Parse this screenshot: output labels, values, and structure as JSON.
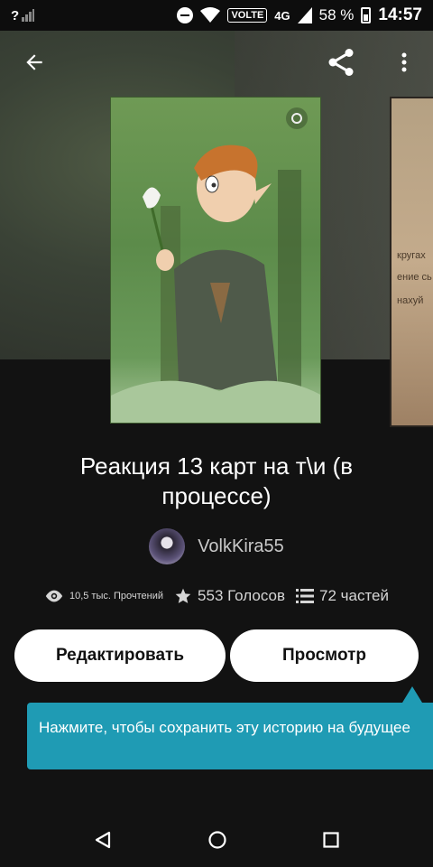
{
  "status_bar": {
    "signal_label": "?",
    "volte_label": "VOLTE",
    "network_label": "4G",
    "battery_text": "58 %",
    "time": "14:57"
  },
  "story": {
    "title": "Реакция 13 карт на т\\и (в процессе)",
    "author": "VolkKira55",
    "reads": "10,5 тыс. Прочтений",
    "votes": "553 Голосов",
    "parts": "72 частей"
  },
  "actions": {
    "edit_label": "Редактировать",
    "view_label": "Просмотр"
  },
  "tooltip": {
    "text": "Нажмите, чтобы сохранить эту историю на будущее"
  },
  "next_cover_text": [
    "кругах",
    "ение сь",
    "нахуй"
  ],
  "icons": {
    "back": "arrow-left-icon",
    "share": "share-icon",
    "more": "more-vertical-icon",
    "reads": "eye-icon",
    "votes": "star-icon",
    "parts": "list-icon"
  },
  "colors": {
    "background": "#121212",
    "tooltip": "#1f9bb4",
    "button": "#ffffff"
  }
}
